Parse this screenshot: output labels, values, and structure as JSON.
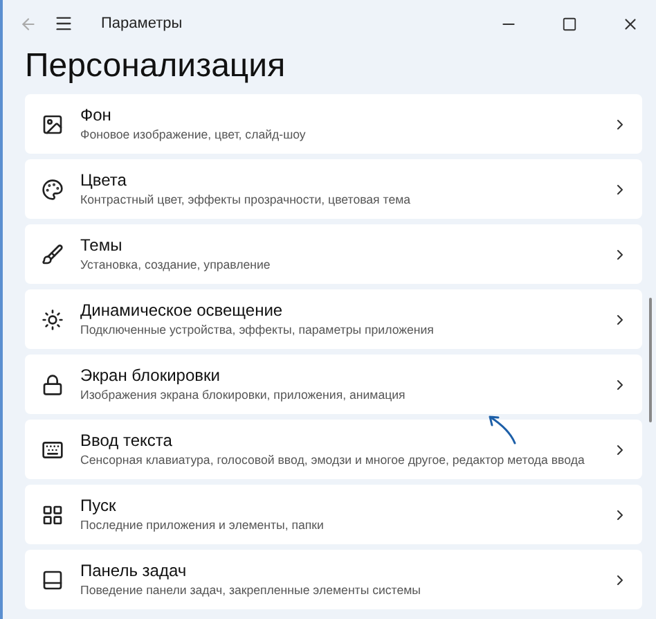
{
  "window": {
    "title": "Параметры"
  },
  "heading": "Персонализация",
  "items": [
    {
      "kind": "image",
      "title": "Фон",
      "subtitle": "Фоновое изображение, цвет, слайд-шоу"
    },
    {
      "kind": "palette",
      "title": "Цвета",
      "subtitle": "Контрастный цвет, эффекты прозрачности, цветовая тема"
    },
    {
      "kind": "brush",
      "title": "Темы",
      "subtitle": "Установка, создание, управление"
    },
    {
      "kind": "light",
      "title": "Динамическое освещение",
      "subtitle": "Подключенные устройства, эффекты, параметры приложения"
    },
    {
      "kind": "lock",
      "title": "Экран блокировки",
      "subtitle": "Изображения экрана блокировки, приложения, анимация"
    },
    {
      "kind": "keyboard",
      "title": "Ввод текста",
      "subtitle": "Сенсорная клавиатура, голосовой ввод, эмодзи и многое другое, редактор метода ввода"
    },
    {
      "kind": "start",
      "title": "Пуск",
      "subtitle": "Последние приложения и элементы, папки"
    },
    {
      "kind": "taskbar",
      "title": "Панель задач",
      "subtitle": "Поведение панели задач, закрепленные элементы системы"
    }
  ]
}
